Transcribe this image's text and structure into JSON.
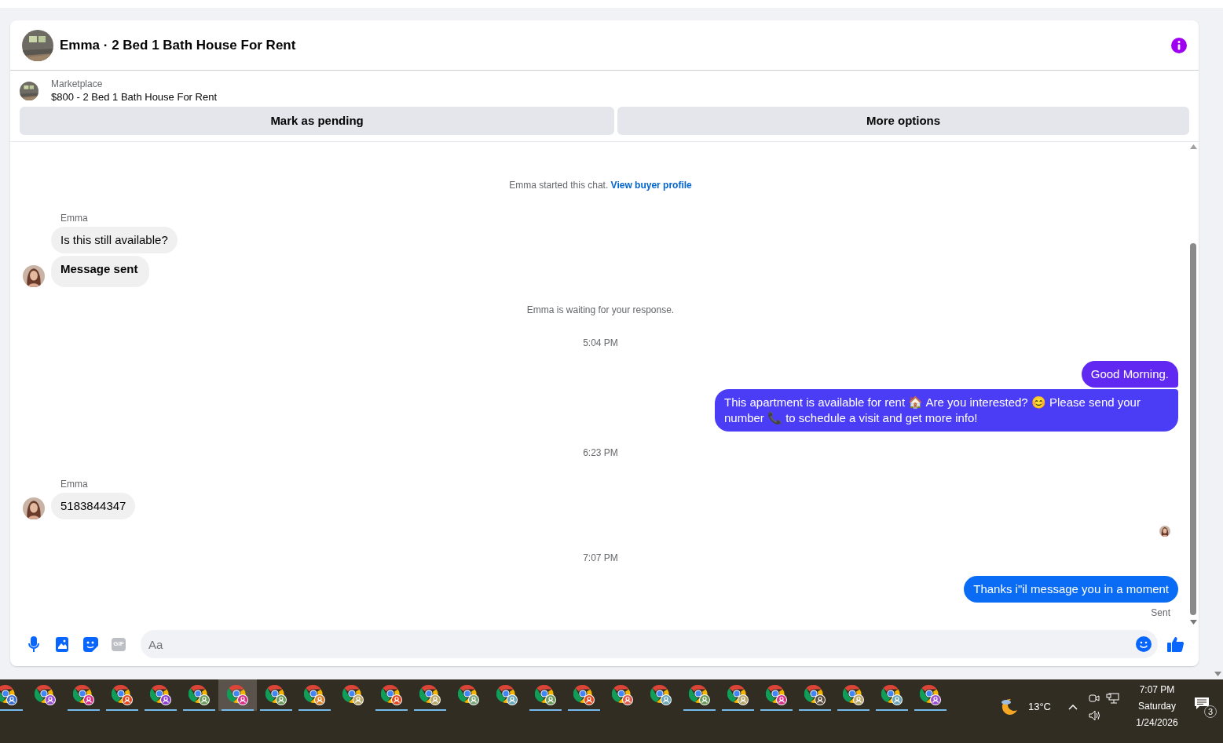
{
  "header": {
    "title": "Emma · 2 Bed 1 Bath House For Rent"
  },
  "listing": {
    "source": "Marketplace",
    "title": "$800 - 2 Bed 1 Bath House For Rent"
  },
  "actions": [
    "Mark as pending",
    "More options"
  ],
  "messages": [
    {
      "kind": "notice",
      "text": "Emma started this chat.",
      "link": "View buyer profile"
    },
    {
      "kind": "incoming",
      "sender": "Emma",
      "bubbles": [
        {
          "text": "Is this still available?",
          "bold": false
        },
        {
          "text": "Message sent",
          "bold": true
        }
      ]
    },
    {
      "kind": "notice",
      "text": "Emma is waiting for your response."
    },
    {
      "kind": "time",
      "text": "5:04 PM"
    },
    {
      "kind": "outgoing",
      "bubbles": [
        {
          "text": "Good Morning.",
          "color": "#6128f2"
        },
        {
          "text": "This apartment is available for rent 🏠 Are you interested? 😊 Please send your number 📞 to schedule a visit and get more info!",
          "color": "#4b3cf6"
        }
      ]
    },
    {
      "kind": "time",
      "text": "6:23 PM"
    },
    {
      "kind": "incoming",
      "sender": "Emma",
      "bubbles": [
        {
          "text": "5183844347",
          "bold": false
        }
      ]
    },
    {
      "kind": "seen"
    },
    {
      "kind": "time",
      "text": "7:07 PM"
    },
    {
      "kind": "outgoing",
      "bubbles": [
        {
          "text": "Thanks i\"il message you in a moment",
          "color": "#0a6cf5"
        }
      ],
      "status": "Sent"
    }
  ],
  "composer": {
    "placeholder": "Aa",
    "gif_label": "GIF"
  },
  "taskbar": {
    "apps": [
      {
        "color": "#3b6fd4",
        "running": true,
        "selected": false
      },
      {
        "color": "#9b4fd0",
        "running": false,
        "selected": false
      },
      {
        "color": "#d6308a",
        "running": true,
        "selected": false
      },
      {
        "color": "#e2491f",
        "running": true,
        "selected": false
      },
      {
        "color": "#8b3fd0",
        "running": true,
        "selected": false
      },
      {
        "color": "#6a9a5a",
        "running": true,
        "selected": false
      },
      {
        "color": "#d6308a",
        "running": true,
        "selected": true
      },
      {
        "color": "#6a9a5a",
        "running": true,
        "selected": false
      },
      {
        "color": "#d9822b",
        "running": true,
        "selected": false
      },
      {
        "color": "#b9a76a",
        "running": false,
        "selected": false
      },
      {
        "color": "#e2491f",
        "running": true,
        "selected": false
      },
      {
        "color": "#b9a76a",
        "running": true,
        "selected": false
      },
      {
        "color": "#7aa37a",
        "running": false,
        "selected": false
      },
      {
        "color": "#6aa6b8",
        "running": false,
        "selected": false
      },
      {
        "color": "#6a9a5a",
        "running": true,
        "selected": false
      },
      {
        "color": "#e2491f",
        "running": true,
        "selected": false
      },
      {
        "color": "#e25a4a",
        "running": false,
        "selected": false
      },
      {
        "color": "#6aa6b8",
        "running": false,
        "selected": false
      },
      {
        "color": "#6a9a5a",
        "running": true,
        "selected": false
      },
      {
        "color": "#b9a76a",
        "running": true,
        "selected": false
      },
      {
        "color": "#d6308a",
        "running": true,
        "selected": false
      },
      {
        "color": "#5a4a3a",
        "running": true,
        "selected": false
      },
      {
        "color": "#b9a76a",
        "running": true,
        "selected": false
      },
      {
        "color": "#6aa6b8",
        "running": true,
        "selected": false
      },
      {
        "color": "#9b4fd0",
        "running": true,
        "selected": false
      }
    ],
    "temperature": "13°C",
    "time": "7:07 PM",
    "day": "Saturday",
    "date": "1/24/2026",
    "notifications": "3"
  }
}
